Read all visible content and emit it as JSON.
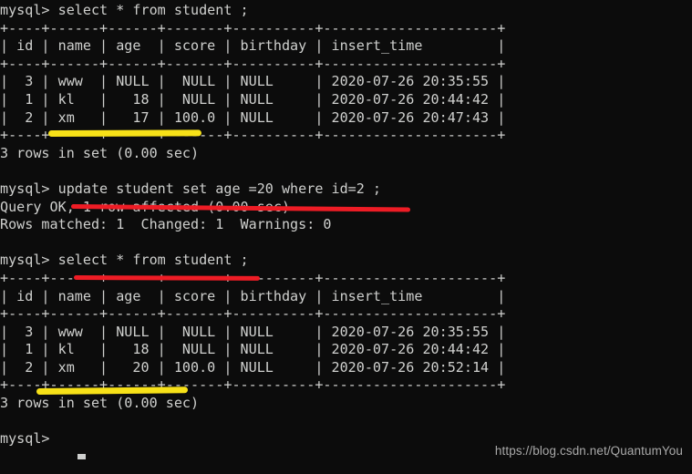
{
  "terminal": {
    "prompt": "mysql>",
    "lines": [
      "mysql> select * from student ;",
      "+----+------+------+-------+----------+---------------------+",
      "| id | name | age  | score | birthday | insert_time         |",
      "+----+------+------+-------+----------+---------------------+",
      "|  3 | www  | NULL |  NULL | NULL     | 2020-07-26 20:35:55 |",
      "|  1 | kl   |   18 |  NULL | NULL     | 2020-07-26 20:44:42 |",
      "|  2 | xm   |   17 | 100.0 | NULL     | 2020-07-26 20:47:43 |",
      "+----+------+------+-------+----------+---------------------+",
      "3 rows in set (0.00 sec)",
      "",
      "mysql> update student set age =20 where id=2 ;",
      "Query OK, 1 row affected (0.00 sec)",
      "Rows matched: 1  Changed: 1  Warnings: 0",
      "",
      "mysql> select * from student ;",
      "+----+------+------+-------+----------+---------------------+",
      "| id | name | age  | score | birthday | insert_time         |",
      "+----+------+------+-------+----------+---------------------+",
      "|  3 | www  | NULL |  NULL | NULL     | 2020-07-26 20:35:55 |",
      "|  1 | kl   |   18 |  NULL | NULL     | 2020-07-26 20:44:42 |",
      "|  2 | xm   |   20 | 100.0 | NULL     | 2020-07-26 20:52:14 |",
      "+----+------+------+-------+----------+---------------------+",
      "3 rows in set (0.00 sec)",
      "",
      "mysql>"
    ],
    "commands": [
      "select * from student ;",
      "update student set age =20 where id=2 ;",
      "select * from student ;"
    ],
    "result_tables": [
      {
        "columns": [
          "id",
          "name",
          "age",
          "score",
          "birthday",
          "insert_time"
        ],
        "rows": [
          [
            "3",
            "www",
            "NULL",
            "NULL",
            "NULL",
            "2020-07-26 20:35:55"
          ],
          [
            "1",
            "kl",
            "18",
            "NULL",
            "NULL",
            "2020-07-26 20:44:42"
          ],
          [
            "2",
            "xm",
            "17",
            "100.0",
            "NULL",
            "2020-07-26 20:47:43"
          ]
        ],
        "footer": "3 rows in set (0.00 sec)"
      },
      {
        "columns": [
          "id",
          "name",
          "age",
          "score",
          "birthday",
          "insert_time"
        ],
        "rows": [
          [
            "3",
            "www",
            "NULL",
            "NULL",
            "NULL",
            "2020-07-26 20:35:55"
          ],
          [
            "1",
            "kl",
            "18",
            "NULL",
            "NULL",
            "2020-07-26 20:44:42"
          ],
          [
            "2",
            "xm",
            "20",
            "100.0",
            "NULL",
            "2020-07-26 20:52:14"
          ]
        ],
        "footer": "3 rows in set (0.00 sec)"
      }
    ],
    "update_output": {
      "status": "Query OK, 1 row affected (0.00 sec)",
      "detail": "Rows matched: 1  Changed: 1  Warnings: 0"
    }
  },
  "annotations": {
    "red_underline_1": "update student set age =20 where id=2",
    "red_underline_2": "select * from student",
    "yellow_highlight_1": "row 2 age 17 before update",
    "yellow_highlight_2": "row 2 age 20 after update",
    "colors": {
      "red": "#ee1c25",
      "yellow": "#f7e118",
      "text": "#cfd0ce",
      "background": "#0c0c0c",
      "watermark": "#a9a9a9"
    }
  },
  "watermark": {
    "text": "https://blog.csdn.net/QuantumYou"
  }
}
